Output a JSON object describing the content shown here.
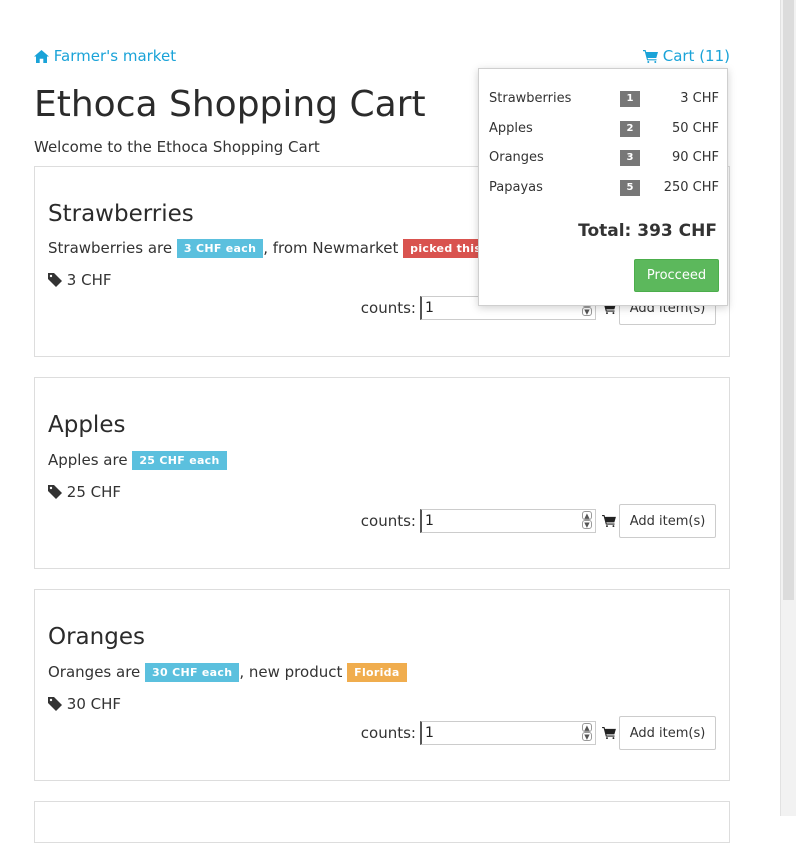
{
  "nav": {
    "home_label": "Farmer's market",
    "cart_label": "Cart (11)"
  },
  "page": {
    "title": "Ethoca Shopping Cart",
    "welcome": "Welcome to the Ethoca Shopping Cart"
  },
  "products": [
    {
      "name": "Strawberries",
      "desc_prefix": "Strawberries are",
      "price_badge": "3 CHF each",
      "desc_mid": ", from Newmarket",
      "extra_badge": "picked this morn",
      "price": "3 CHF",
      "counts_label": "counts:",
      "count_value": "1",
      "add_label": "Add item(s)"
    },
    {
      "name": "Apples",
      "desc_prefix": "Apples are",
      "price_badge": "25 CHF each",
      "price": "25 CHF",
      "counts_label": "counts:",
      "count_value": "1",
      "add_label": "Add item(s)"
    },
    {
      "name": "Oranges",
      "desc_prefix": "Oranges are",
      "price_badge": "30 CHF each",
      "desc_mid": ", new product",
      "extra_badge": "Florida",
      "price": "30 CHF",
      "counts_label": "counts:",
      "count_value": "1",
      "add_label": "Add item(s)"
    }
  ],
  "cart": {
    "items": [
      {
        "name": "Strawberries",
        "qty": "1",
        "amount": "3 CHF"
      },
      {
        "name": "Apples",
        "qty": "2",
        "amount": "50 CHF"
      },
      {
        "name": "Oranges",
        "qty": "3",
        "amount": "90 CHF"
      },
      {
        "name": "Papayas",
        "qty": "5",
        "amount": "250 CHF"
      }
    ],
    "total": "Total: 393 CHF",
    "proceed_label": "Procceed"
  },
  "colors": {
    "link": "#1aa3d8",
    "info": "#5bc0de",
    "danger": "#d9534f",
    "warning": "#f0ad4e",
    "success": "#5cb85c"
  }
}
